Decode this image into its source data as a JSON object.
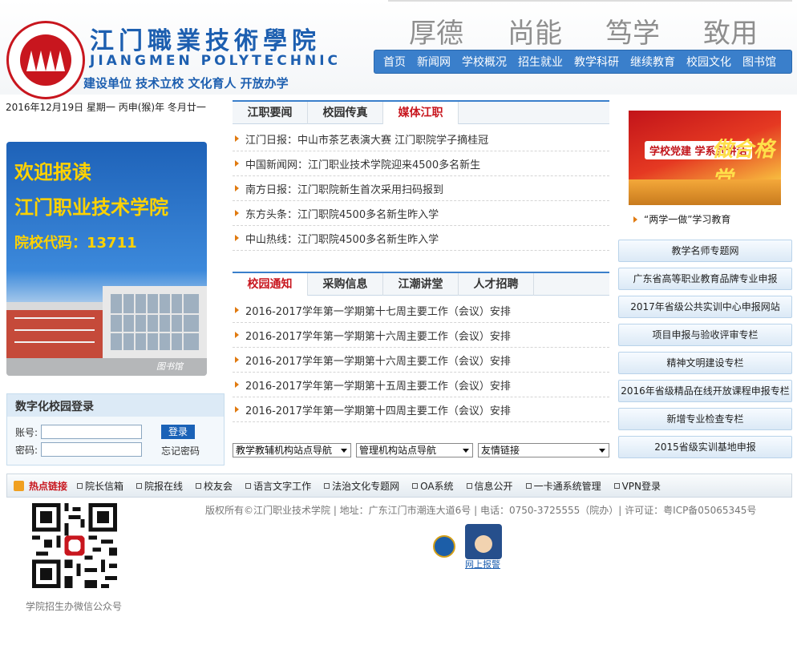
{
  "header": {
    "school_cn": "江门職業技術學院",
    "school_en": "JIANGMEN POLYTECHNIC",
    "slogan": "建设单位  技术立校  文化育人  开放办学",
    "motto": [
      "厚德",
      "尚能",
      "笃学",
      "致用"
    ],
    "nav": [
      "首页",
      "新闻网",
      "学校概况",
      "招生就业",
      "教学科研",
      "继续教育",
      "校园文化",
      "图书馆"
    ]
  },
  "date": "2016年12月19日  星期一   丙申(猴)年 冬月廿一",
  "banner": {
    "line1": "欢迎报读",
    "line2": "江门职业技术学院",
    "line3": "院校代码：13711",
    "caption": "图书馆"
  },
  "login": {
    "title": "数字化校园登录",
    "account_label": "账号:",
    "password_label": "密码:",
    "login_button": "登录",
    "forgot": "忘记密码"
  },
  "news": {
    "tabs": [
      "江职要闻",
      "校园传真",
      "媒体江职"
    ],
    "active_tab": 2,
    "items": [
      "江门日报：中山市茶艺表演大赛 江门职院学子摘桂冠",
      "中国新闻网：江门职业技术学院迎来4500多名新生",
      "南方日报：江门职院新生首次采用扫码报到",
      "东方头条：江门职院4500多名新生昨入学",
      "中山热线：江门职院4500多名新生昨入学"
    ]
  },
  "notices": {
    "tabs": [
      "校园通知",
      "采购信息",
      "江潮讲堂",
      "人才招聘"
    ],
    "active_tab": 0,
    "items": [
      "2016-2017学年第一学期第十七周主要工作（会议）安排",
      "2016-2017学年第一学期第十六周主要工作（会议）安排",
      "2016-2017学年第一学期第十六周主要工作（会议）安排",
      "2016-2017学年第一学期第十五周主要工作（会议）安排",
      "2016-2017学年第一学期第十四周主要工作（会议）安排"
    ]
  },
  "selects": [
    "教学教辅机构站点导航",
    "管理机构站点导航",
    "友情链接"
  ],
  "right": {
    "image_title": "学校党建 学系列讲话",
    "image_slogan": "做合格党",
    "caption": "“两学一做”学习教育",
    "buttons": [
      "教学名师专题网",
      "广东省高等职业教育品牌专业申报",
      "2017年省级公共实训中心申报网站",
      "项目申报与验收评审专栏",
      "精神文明建设专栏",
      "2016年省级精品在线开放课程申报专栏",
      "新增专业检查专栏",
      "2015省级实训基地申报"
    ]
  },
  "hotlinks": {
    "label": "热点链接",
    "items": [
      "院长信箱",
      "院报在线",
      "校友会",
      "语言文字工作",
      "法治文化专题网",
      "OA系统",
      "信息公开",
      "一卡通系统管理",
      "VPN登录"
    ]
  },
  "footer": {
    "copyright": "版权所有©江门职业技术学院  |  地址：广东江门市潮连大道6号  |  电话：0750-3725555（院办）|  许可证：粤ICP备05065345号",
    "qr_label": "学院招生办微信公众号",
    "police_label": "网上报警"
  },
  "colors": {
    "brand_blue": "#1d5fb0",
    "nav_blue": "#3a7fcb",
    "accent_red": "#c8161e",
    "bullet_orange": "#e07a10"
  }
}
